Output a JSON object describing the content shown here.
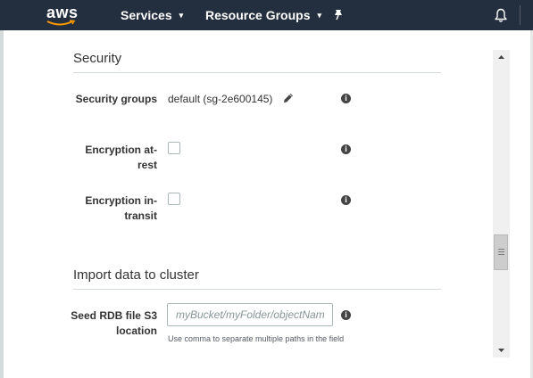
{
  "nav": {
    "logo": "aws",
    "services": "Services",
    "resource_groups": "Resource Groups",
    "caret": "▾"
  },
  "security": {
    "title": "Security",
    "groups_label": "Security groups",
    "groups_value": "default (sg-2e600145)",
    "encryption_rest_label": "Encryption at-rest",
    "encryption_rest_checked": false,
    "encryption_transit_label": "Encryption in-transit",
    "encryption_transit_checked": false
  },
  "import": {
    "title": "Import data to cluster",
    "seed_label": "Seed RDB file S3 location",
    "seed_placeholder": "myBucket/myFolder/objectName",
    "seed_value": "",
    "hint": "Use comma to separate multiple paths in the field"
  },
  "info_glyph": "i",
  "colors": {
    "nav_bg": "#232f3e",
    "page_bg": "#f2f3f3",
    "panel_bg": "#ffffff",
    "rule": "#d5dbdb"
  }
}
